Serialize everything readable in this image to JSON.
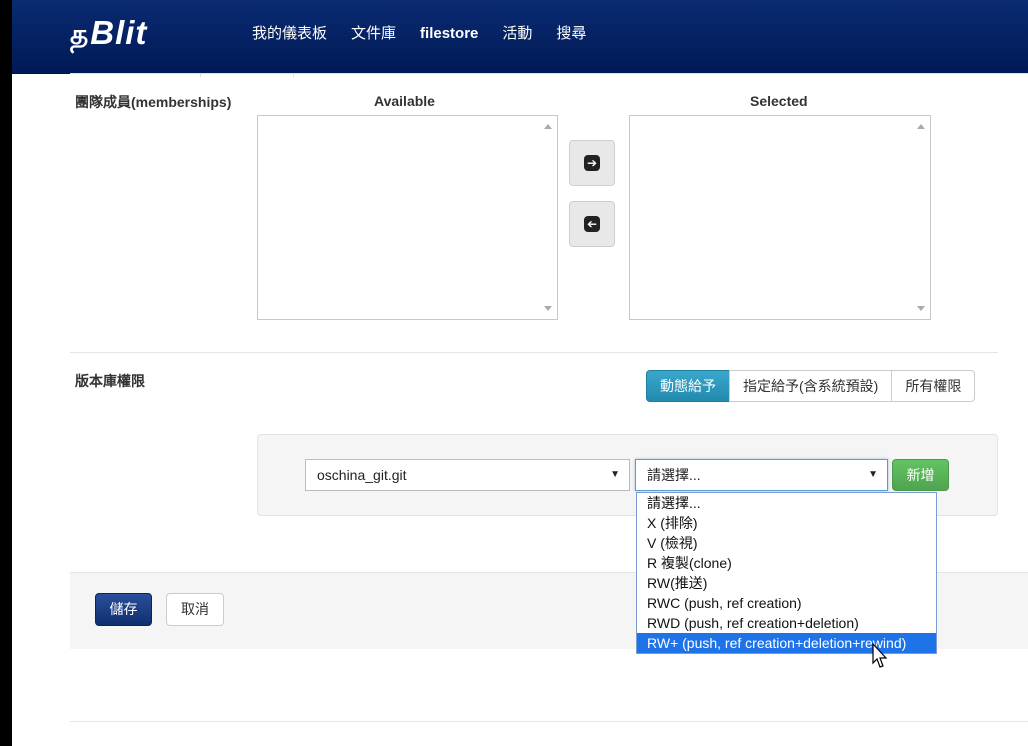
{
  "nav": {
    "brand_glyph": "த",
    "brand_text": "Blit",
    "items": [
      "我的儀表板",
      "文件庫",
      "filestore",
      "活動",
      "搜尋"
    ]
  },
  "memberships": {
    "label": "團隊成員(memberships)",
    "available_label": "Available",
    "selected_label": "Selected",
    "move_right_icon": "arrow-right-icon",
    "move_left_icon": "arrow-left-icon"
  },
  "permissions": {
    "label": "版本庫權限",
    "modes": [
      "動態給予",
      "指定給予(含系統預設)",
      "所有權限"
    ],
    "active_mode": "動態給予",
    "repo_select_value": "oschina_git.git",
    "perm_select_value": "請選擇...",
    "add_label": "新增",
    "options": [
      "請選擇...",
      "X (排除)",
      "V (檢視)",
      "R 複製(clone)",
      "RW(推送)",
      "RWC (push, ref creation)",
      "RWD (push, ref creation+deletion)",
      "RW+ (push, ref creation+deletion+rewind)"
    ],
    "highlighted_option": "RW+ (push, ref creation+deletion+rewind)"
  },
  "footer": {
    "save_label": "儲存",
    "cancel_label": "取消"
  },
  "colors": {
    "navbar": "#002060",
    "active_toggle": "#2a9abf",
    "add_button": "#5cb85c",
    "save_button": "#1a3d82",
    "highlight": "#1e73e8"
  }
}
